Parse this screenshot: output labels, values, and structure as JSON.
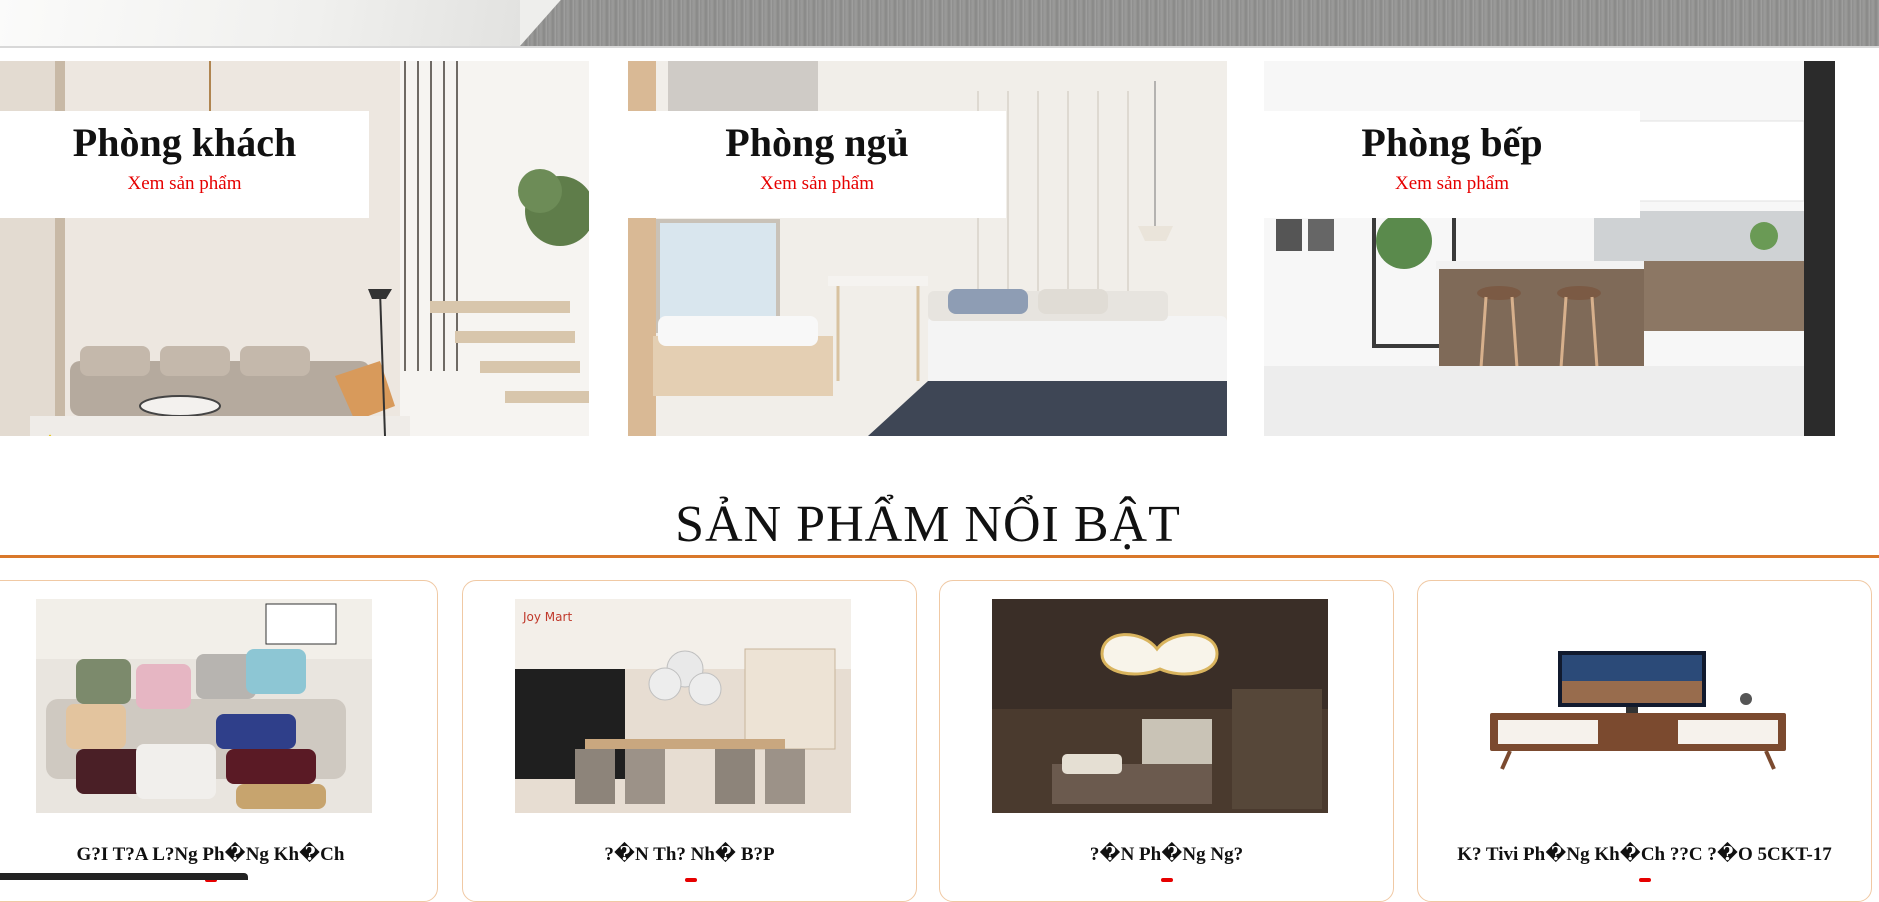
{
  "categories": [
    {
      "title": "Phòng khách",
      "link": "Xem sản phẩm"
    },
    {
      "title": "Phòng ngủ",
      "link": "Xem sản phẩm"
    },
    {
      "title": "Phòng bếp",
      "link": "Xem sản phẩm"
    }
  ],
  "featured": {
    "title": "SẢN PHẨM NỔI BẬT",
    "products": [
      {
        "name": "G?I T?A L?Ng Ph�Ng Kh�Ch"
      },
      {
        "name": "?�N Th? Nh� B?P"
      },
      {
        "name": "?�N Ph�Ng Ng?"
      },
      {
        "name": "K? Tivi Ph�Ng Kh�Ch ??C ?�O 5CKT-17"
      }
    ]
  },
  "colors": {
    "accent_rule": "#d9782a",
    "link_red": "#e60000",
    "card_border": "#f0c9a4"
  }
}
